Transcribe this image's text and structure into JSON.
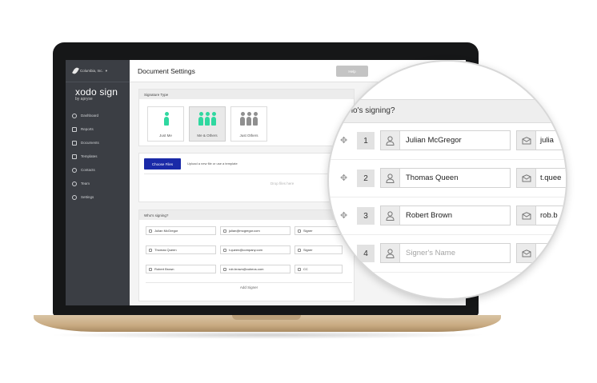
{
  "sidebar": {
    "org_name": "Columbia, Inc.",
    "brand": "xodo sign",
    "brand_sub": "by apryse",
    "items": [
      {
        "label": "Dashboard",
        "icon": "clock-icon"
      },
      {
        "label": "Reports",
        "icon": "bar-chart-icon"
      },
      {
        "label": "Documents",
        "icon": "document-icon"
      },
      {
        "label": "Templates",
        "icon": "template-icon"
      },
      {
        "label": "Contacts",
        "icon": "contacts-icon"
      },
      {
        "label": "Team",
        "icon": "team-icon"
      },
      {
        "label": "Settings",
        "icon": "gear-icon"
      }
    ]
  },
  "header": {
    "title": "Document Settings",
    "help_label": "Help"
  },
  "signature_type": {
    "heading": "Signature Type",
    "options": [
      {
        "label": "Just Me",
        "selected": false
      },
      {
        "label": "Me & Others",
        "selected": true
      },
      {
        "label": "Just Others",
        "selected": false
      }
    ],
    "colors": {
      "accent": "#2fd8a0",
      "muted": "#b4b4b4"
    }
  },
  "upload": {
    "button_label": "Choose Files",
    "hint": "Upload a new file or use a template",
    "drop_text": "Drop files here"
  },
  "signers_small": {
    "heading": "Who's signing?",
    "rows": [
      {
        "name": "Julian McGregor",
        "email": "julian@mcgregor.com",
        "role": "Signer"
      },
      {
        "name": "Thomas Queen",
        "email": "t.queen@company.com",
        "role": "Signer"
      },
      {
        "name": "Robert Brown",
        "email": "rob.brown@cubeos.com",
        "role": "CC"
      }
    ],
    "add_label": "Add Signer"
  },
  "magnifier": {
    "heading": "Who's signing?",
    "rows": [
      {
        "num": "1",
        "name": "Julian McGregor",
        "email": "julia",
        "placeholder": false
      },
      {
        "num": "2",
        "name": "Thomas Queen",
        "email": "t.quee",
        "placeholder": false
      },
      {
        "num": "3",
        "name": "Robert Brown",
        "email": "rob.b",
        "placeholder": false
      },
      {
        "num": "4",
        "name": "Signer's Name",
        "email": "",
        "placeholder": true
      }
    ]
  }
}
